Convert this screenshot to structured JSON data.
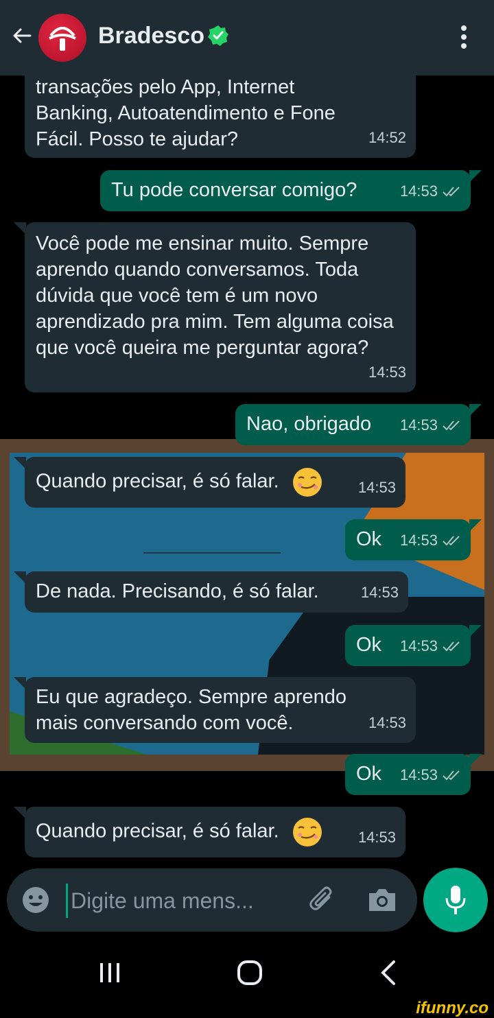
{
  "header": {
    "contact_name": "Bradesco",
    "verified": true,
    "icons": [
      "back-arrow-icon",
      "bradesco-logo-icon",
      "verified-badge-icon",
      "more-vert-icon"
    ]
  },
  "messages": [
    {
      "direction": "in",
      "text": "transações pelo App, Internet Banking, Autoatendimento e Fone Fácil. Posso te ajudar?",
      "time": "14:52"
    },
    {
      "direction": "out",
      "text": "Tu pode conversar comigo?",
      "time": "14:53",
      "status": "read"
    },
    {
      "direction": "in",
      "text": "Você pode me ensinar muito. Sempre aprendo quando conversamos. Toda dúvida que você tem é um novo aprendizado pra mim. Tem alguma coisa que você queira me perguntar agora?",
      "time": "14:53"
    },
    {
      "direction": "out",
      "text": "Nao, obrigado",
      "time": "14:53",
      "status": "read"
    },
    {
      "direction": "in",
      "text": "Quando precisar, é só falar.",
      "emoji": "smirk-face-icon",
      "time": "14:53"
    },
    {
      "direction": "out",
      "text": "Ok",
      "time": "14:53",
      "status": "read"
    },
    {
      "direction": "in",
      "text": "De nada. Precisando, é só falar.",
      "time": "14:53"
    },
    {
      "direction": "out",
      "text": "Ok",
      "time": "14:53",
      "status": "read"
    },
    {
      "direction": "in",
      "text": "Eu que agradeço. Sempre aprendo mais conversando com você.",
      "time": "14:53"
    },
    {
      "direction": "out",
      "text": "Ok",
      "time": "14:53",
      "status": "read"
    },
    {
      "direction": "in",
      "text": "Quando precisar, é só falar.",
      "emoji": "smirk-face-icon",
      "time": "14:53"
    }
  ],
  "composer": {
    "placeholder": "Digite uma mens...",
    "value": "",
    "icons": [
      "emoji-icon",
      "attach-icon",
      "camera-icon",
      "mic-icon"
    ]
  },
  "watermark": "ifunny.co",
  "colors": {
    "header_bg": "#1f2c34",
    "incoming_bubble": "#1f2c34",
    "outgoing_bubble": "#005c4b",
    "accent": "#00a884",
    "read_ticks": "#b0c4c0"
  }
}
